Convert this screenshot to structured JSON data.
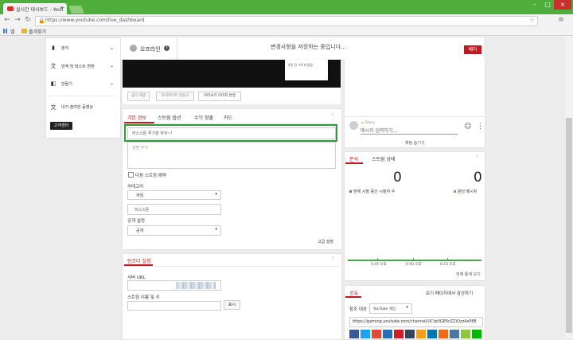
{
  "browser": {
    "tab_title": "실시간 대시보드 - YouT",
    "tab_close": "×",
    "url": "https://www.youtube.com/live_dashboard",
    "bookmarks": [
      {
        "label": "앱"
      },
      {
        "label": "즐겨찾기"
      }
    ],
    "window_controls": [
      "–",
      "□",
      "×"
    ]
  },
  "sidebar": {
    "items": [
      {
        "label": "분석",
        "icon": "bar-chart-icon",
        "chevron": true
      },
      {
        "label": "번역 및 텍스트 변환",
        "icon": "translate-icon",
        "chevron": true
      },
      {
        "label": "만들기",
        "icon": "create-icon",
        "chevron": true
      },
      {
        "label": "내가 참여한 동영상",
        "icon": "contributed-videos-icon",
        "chevron": false
      }
    ],
    "support_button": "고객센터"
  },
  "header": {
    "status_label": "오프라인",
    "status_help": "?",
    "saving_message": "변경사항을 저장하는 중입니다...",
    "beta_badge": "베타"
  },
  "preview": {
    "popup_lines": [
      "",
      "4일 전 스트리밍됨"
    ],
    "buttons": [
      "광고 재생",
      "하이라이트 만들기",
      "미리보기 이미지 변경"
    ]
  },
  "info_card": {
    "tabs": [
      "기본 정보",
      "스트림 옵션",
      "수익 창출",
      "카드"
    ],
    "title_value": "러스스톤 투기장 하자~!",
    "description_placeholder": "설명 추가",
    "schedule_checkbox_label": "다음 스트림 예약",
    "category_label": "카테고리",
    "category_value": "게임",
    "game_value": "하스스톤",
    "privacy_label": "공개 설정",
    "privacy_value": "공개",
    "advanced_link": "고급 설정"
  },
  "encoder_card": {
    "title": "인코더 설정",
    "server_url_label": "서버 URL",
    "stream_key_label": "스트림 이름 및 키",
    "show_button": "표시"
  },
  "chat": {
    "user_tag": "Story",
    "input_placeholder": "메시지 입력하기...",
    "hide_chat": "채팅 숨기기"
  },
  "analytics": {
    "tabs": [
      "분석",
      "스트림 상태"
    ],
    "concurrent_viewers": "0",
    "chat_rate": "0",
    "concurrent_label": "현재 시청 중인 시청자 수",
    "chat_label": "분당 메시지",
    "time_ticks": [
      "5:45 오후",
      "6:00 오후",
      "6:15 오후"
    ],
    "full_analytics_link": "전체 통계 보기"
  },
  "share": {
    "title": "공유",
    "watch_page_link": "보기 페이지에서 감상하기",
    "promote_label": "참조 대상",
    "promote_value": "YouTube 게임",
    "share_url": "https://gaming.youtube.com/channel/UCtp0GE6cZZiOzzAzP88"
  },
  "colors": {
    "chrome_green": "#4fae3b",
    "accent_red": "#c4161c",
    "focus_green": "#2e9a3e",
    "chart_green": "#47a447",
    "viewer_blue": "#2f8ad6",
    "chat_green": "#66bb44"
  }
}
